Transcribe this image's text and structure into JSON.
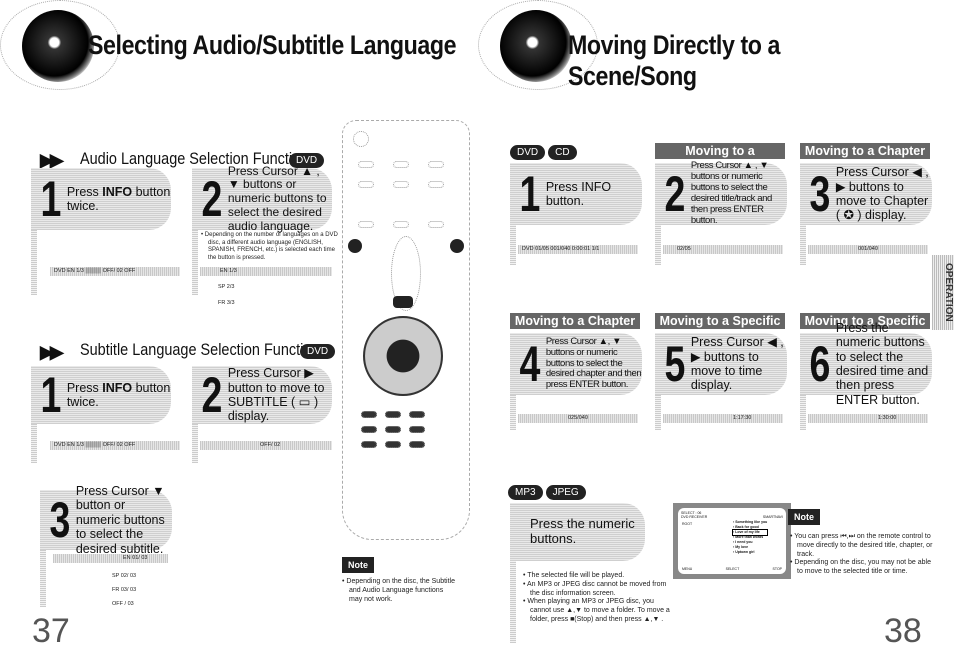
{
  "left": {
    "title": "Selecting Audio/Subtitle Language",
    "audio": {
      "heading": "Audio Language Selection Function",
      "badge": "DVD",
      "step1": {
        "num": "1",
        "pre": "Press ",
        "bold": "INFO",
        "post": " button twice."
      },
      "step2": {
        "num": "2",
        "text": "Press Cursor ▲ , ▼ buttons or numeric buttons to select the desired audio language."
      },
      "bullet": "Depending on the number of languages on a DVD disc, a different audio language (ENGLISH, SPANISH, FRENCH, etc.) is selected each time the button is pressed.",
      "bar1": "DVD  EN 1/3  ▒▒▒▒  OFF/ 02   OFF",
      "bar2": "EN 1/3",
      "options": [
        "SP 2/3",
        "FR 3/3"
      ]
    },
    "subtitle": {
      "heading": "Subtitle Language Selection Function",
      "badge": "DVD",
      "step1": {
        "num": "1",
        "pre": "Press ",
        "bold": "INFO",
        "post": " button twice."
      },
      "step2": {
        "num": "2",
        "text": "Press Cursor ▶ button to move to SUBTITLE ( ▭ ) display."
      },
      "step3": {
        "num": "3",
        "text": "Press Cursor ▼ button or numeric buttons to select the desired subtitle."
      },
      "bar1": "DVD  EN 1/3  ▒▒▒▒  OFF/ 02   OFF",
      "bar2": "OFF/ 02",
      "bar3": "EN 01/ 03",
      "options": [
        "SP 02/ 03",
        "FR 03/ 03",
        "OFF / 03"
      ]
    },
    "note": {
      "label": "Note",
      "text": "Depending on the disc, the Subtitle and Audio Language functions may not work."
    },
    "page": "37"
  },
  "right": {
    "title": "Moving Directly to a Scene/Song",
    "badges": [
      "DVD",
      "CD"
    ],
    "headers": [
      "Moving to a Title/Track",
      "Moving to a Chapter",
      "Moving to a Chapter",
      "Moving to a Specific Time",
      "Moving to a Specific Time"
    ],
    "steps": [
      {
        "num": "1",
        "text": "Press INFO button."
      },
      {
        "num": "2",
        "text": "Press Cursor ▲ , ▼ buttons or numeric buttons to select the desired title/track and then press ENTER button."
      },
      {
        "num": "3",
        "text": "Press Cursor ◀ , ▶ buttons to move to Chapter ( ✪ ) display."
      },
      {
        "num": "4",
        "text": "Press Cursor ▲, ▼ buttons or numeric buttons to select the desired chapter and then press ENTER button."
      },
      {
        "num": "5",
        "text": "Press Cursor ◀ , ▶ buttons to move to time display."
      },
      {
        "num": "6",
        "text": "Press the numeric buttons to select the desired time and then press ENTER button."
      }
    ],
    "bars": [
      "DVD  01/05   001/040   0:00:01   1/1",
      "02/05",
      "001/040",
      "025/040",
      "1:17:30",
      "1:30:00"
    ],
    "mp3": {
      "badges": [
        "MP3",
        "JPEG"
      ],
      "step": "Press the numeric buttons.",
      "bullets": [
        "The selected file will be played.",
        "An MP3 or JPEG disc cannot be moved from the disc information screen.",
        "When playing an MP3 or JPEG disc, you cannot use ▲,▼ to move a folder. To move a folder, press ■(Stop) and then press ▲,▼ ."
      ],
      "screen": {
        "select": "SELECT : 06",
        "device": "DVD RECEIVER",
        "mode": "SMARTNAVI",
        "folder": "ROOT",
        "tracks": [
          "Something like you",
          "Back for good",
          "Love of my life",
          "More than words",
          "I need you",
          "My love",
          "Uptown girl"
        ],
        "footer": [
          "MENU",
          "SELECT",
          "STOP"
        ]
      }
    },
    "note": {
      "label": "Note",
      "bullets": [
        "You can press ⏮,⏭ on the remote control to move directly to the desired title, chapter, or track.",
        "Depending on the disc, you may not be able to move to the selected title or time."
      ]
    },
    "tab": "OPERATION",
    "page": "38"
  }
}
